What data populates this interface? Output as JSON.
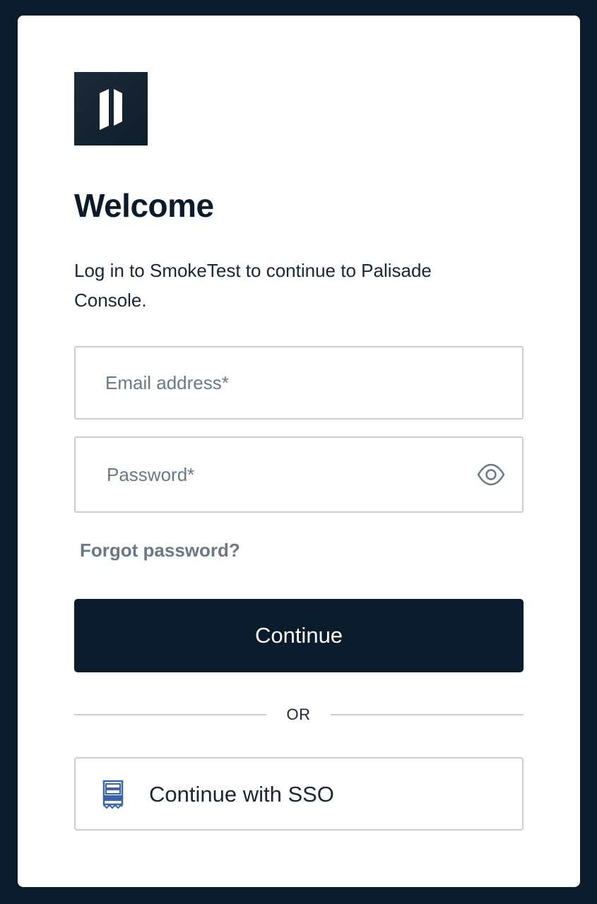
{
  "brand": {
    "logo_icon": "palisade-logo-icon",
    "logo_bg_color": "#1c2b3a"
  },
  "header": {
    "title": "Welcome",
    "subtitle": "Log in to SmokeTest to continue to Palisade Console."
  },
  "form": {
    "email": {
      "placeholder": "Email address*",
      "value": ""
    },
    "password": {
      "placeholder": "Password*",
      "value": "",
      "toggle_icon": "eye-icon"
    },
    "forgot_password_label": "Forgot password?",
    "continue_label": "Continue"
  },
  "divider": {
    "label": "OR"
  },
  "sso": {
    "label": "Continue with SSO",
    "icon": "sso-document-icon"
  },
  "colors": {
    "page_bg": "#0a1b2c",
    "primary": "#0a1b2c",
    "muted_text": "#6b7885",
    "border": "#c9ced6",
    "sso_icon_blue": "#3a63b0"
  }
}
